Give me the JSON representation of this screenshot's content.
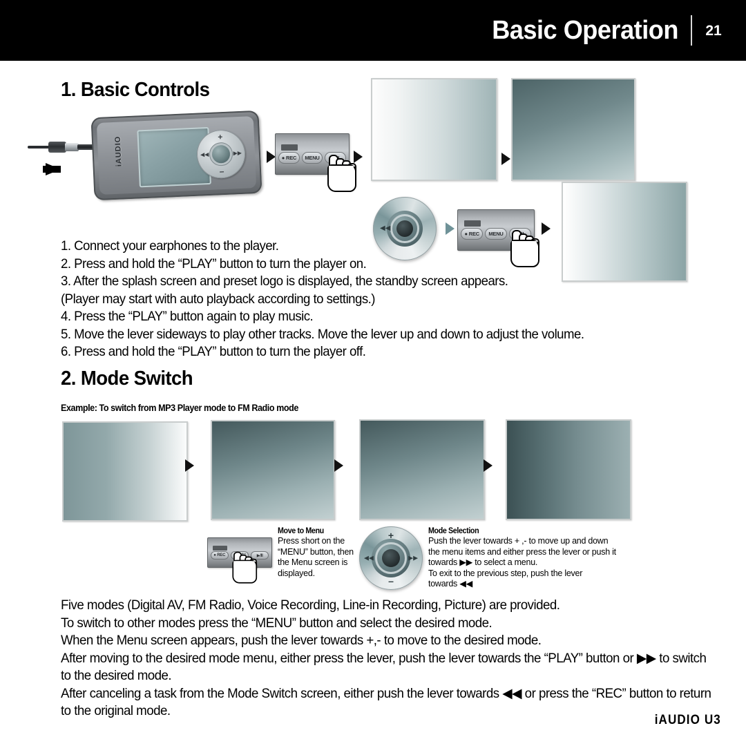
{
  "header": {
    "title": "Basic Operation",
    "page_number": "21",
    "background_color": "#000000",
    "text_color": "#ffffff"
  },
  "sections": {
    "basic_controls": {
      "heading": "1. Basic Controls",
      "steps": [
        "1. Connect your earphones to the player.",
        "2. Press and hold the “PLAY” button to turn the player on.",
        "3. After the splash screen and preset logo is displayed, the standby screen appears.",
        " (Player may start with auto playback according to settings.)",
        "4. Press the “PLAY” button again to play music.",
        "5. Move the lever sideways to play other tracks. Move the lever up and down to adjust the volume.",
        "6. Press and hold the “PLAY” button to turn the player off."
      ]
    },
    "mode_switch": {
      "heading": "2. Mode Switch",
      "example": "Example: To switch from MP3 Player mode to FM Radio mode",
      "callouts": [
        {
          "title": "Move to Menu",
          "lines": [
            "Press short on the",
            "“MENU” button, then",
            "the Menu screen is",
            "displayed."
          ]
        },
        {
          "title": "Mode Selection",
          "lines": [
            "Push the lever towards + ,- to move up and down",
            "the menu items and either press the lever or push it",
            "towards ▶▶ to select a menu.",
            "To exit to the previous step, push the lever",
            "towards ◀◀"
          ]
        }
      ],
      "paragraph": [
        "Five modes (Digital AV, FM Radio, Voice Recording, Line-in Recording, Picture) are provided.",
        "To switch to other modes press the “MENU” button and select the desired mode.",
        "When the Menu screen appears, push the lever towards +,- to move to the desired mode.",
        "After moving to the desired mode menu, either press the lever, push the lever towards the “PLAY” button or  ▶▶  to switch",
        "to the desired mode.",
        "After canceling a task from the Mode Switch screen, either push the lever towards ◀◀ or press the “REC” button to return",
        "to the original mode."
      ]
    }
  },
  "device": {
    "brand_label": "iAUDIO",
    "pad_labels": {
      "up": "+",
      "down": "–",
      "left": "◀◀",
      "right": "▶▶"
    }
  },
  "button_strip": {
    "buttons": [
      "● REC",
      "MENU",
      "▶/II"
    ]
  },
  "jog_dial": {
    "labels": {
      "up": "+",
      "down": "–",
      "left": "◀◀",
      "right": "▶▶"
    }
  },
  "screenshots": {
    "top_row": [
      "screen-splash",
      "screen-logo",
      "screen-standby"
    ],
    "bottom_row": [
      "screen-mp3-player",
      "screen-menu",
      "screen-mode-list",
      "screen-fm-radio"
    ]
  },
  "footer": {
    "product": "iAUDIO U3"
  }
}
